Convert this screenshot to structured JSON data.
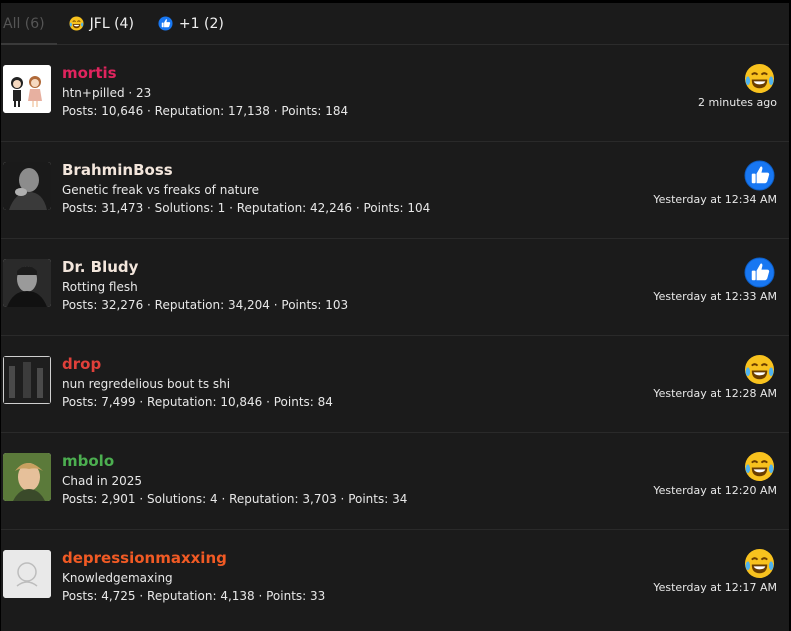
{
  "tabs": [
    {
      "label": "All (6)",
      "icon": null
    },
    {
      "label": "JFL (4)",
      "icon": "laugh-cry-emoji"
    },
    {
      "label": "+1 (2)",
      "icon": "thumbs-up-emoji"
    }
  ],
  "reactions": [
    {
      "name": "mortis",
      "name_color": "#e0245e",
      "title": "htn+pilled · 23",
      "stats": "Posts: 10,646 · Reputation: 17,138 · Points: 184",
      "reaction": "laugh-cry-emoji",
      "time": "2 minutes ago"
    },
    {
      "name": "BrahminBoss",
      "name_color": "#f3e6dc",
      "title": "Genetic freak vs freaks of nature",
      "stats": "Posts: 31,473 · Solutions: 1 · Reputation: 42,246 · Points: 104",
      "reaction": "thumbs-up-emoji",
      "time": "Yesterday at 12:34 AM"
    },
    {
      "name": "Dr. Bludy",
      "name_color": "#f3e6dc",
      "title": "Rotting flesh",
      "stats": "Posts: 32,276 · Reputation: 34,204 · Points: 103",
      "reaction": "thumbs-up-emoji",
      "time": "Yesterday at 12:33 AM"
    },
    {
      "name": "drop",
      "name_color": "#e0403a",
      "title": "nun regredelious bout ts shi",
      "stats": "Posts: 7,499 · Reputation: 10,846 · Points: 84",
      "reaction": "laugh-cry-emoji",
      "time": "Yesterday at 12:28 AM"
    },
    {
      "name": "mbolo",
      "name_color": "#4caf50",
      "title": "Chad in 2025",
      "stats": "Posts: 2,901 · Solutions: 4 · Reputation: 3,703 · Points: 34",
      "reaction": "laugh-cry-emoji",
      "time": "Yesterday at 12:20 AM"
    },
    {
      "name": "depressionmaxxing",
      "name_color": "#f15a24",
      "title": "Knowledgemaxing",
      "stats": "Posts: 4,725 · Reputation: 4,138 · Points: 33",
      "reaction": "laugh-cry-emoji",
      "time": "Yesterday at 12:17 AM"
    }
  ]
}
